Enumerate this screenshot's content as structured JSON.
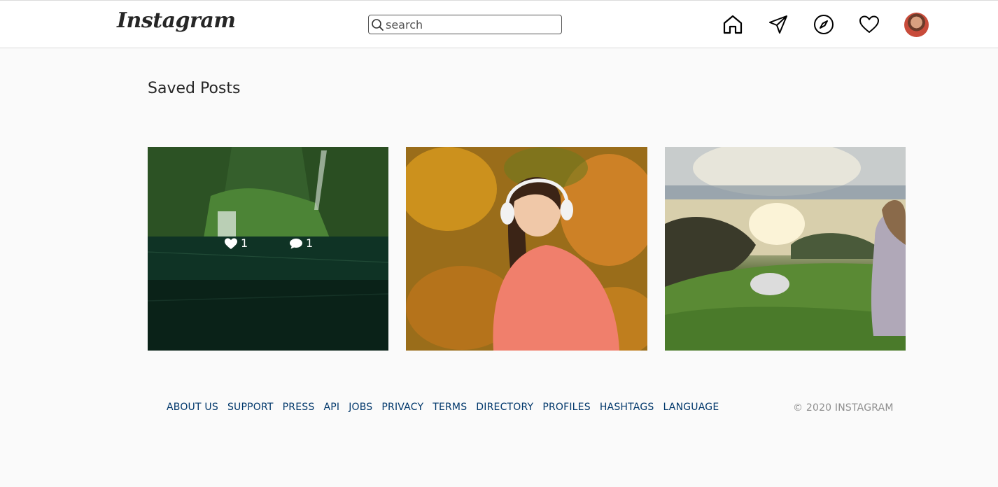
{
  "header": {
    "logo": "Instagram",
    "search": {
      "placeholder": "search",
      "value": ""
    },
    "nav": [
      "home-icon",
      "direct-icon",
      "explore-icon",
      "activity-icon"
    ],
    "avatar": "avatar"
  },
  "main": {
    "title": "Saved Posts",
    "posts": [
      {
        "likes": "1",
        "comments": "1"
      },
      {},
      {}
    ]
  },
  "footer": {
    "links": [
      "ABOUT US",
      "SUPPORT",
      "PRESS",
      "API",
      "JOBS",
      "PRIVACY",
      "TERMS",
      "DIRECTORY",
      "PROFILES",
      "HASHTAGS",
      "LANGUAGE"
    ],
    "copyright": "© 2020 INSTAGRAM"
  },
  "colors": {
    "link": "#00376b",
    "muted": "#8e8e8e",
    "border": "#dbdbdb"
  }
}
